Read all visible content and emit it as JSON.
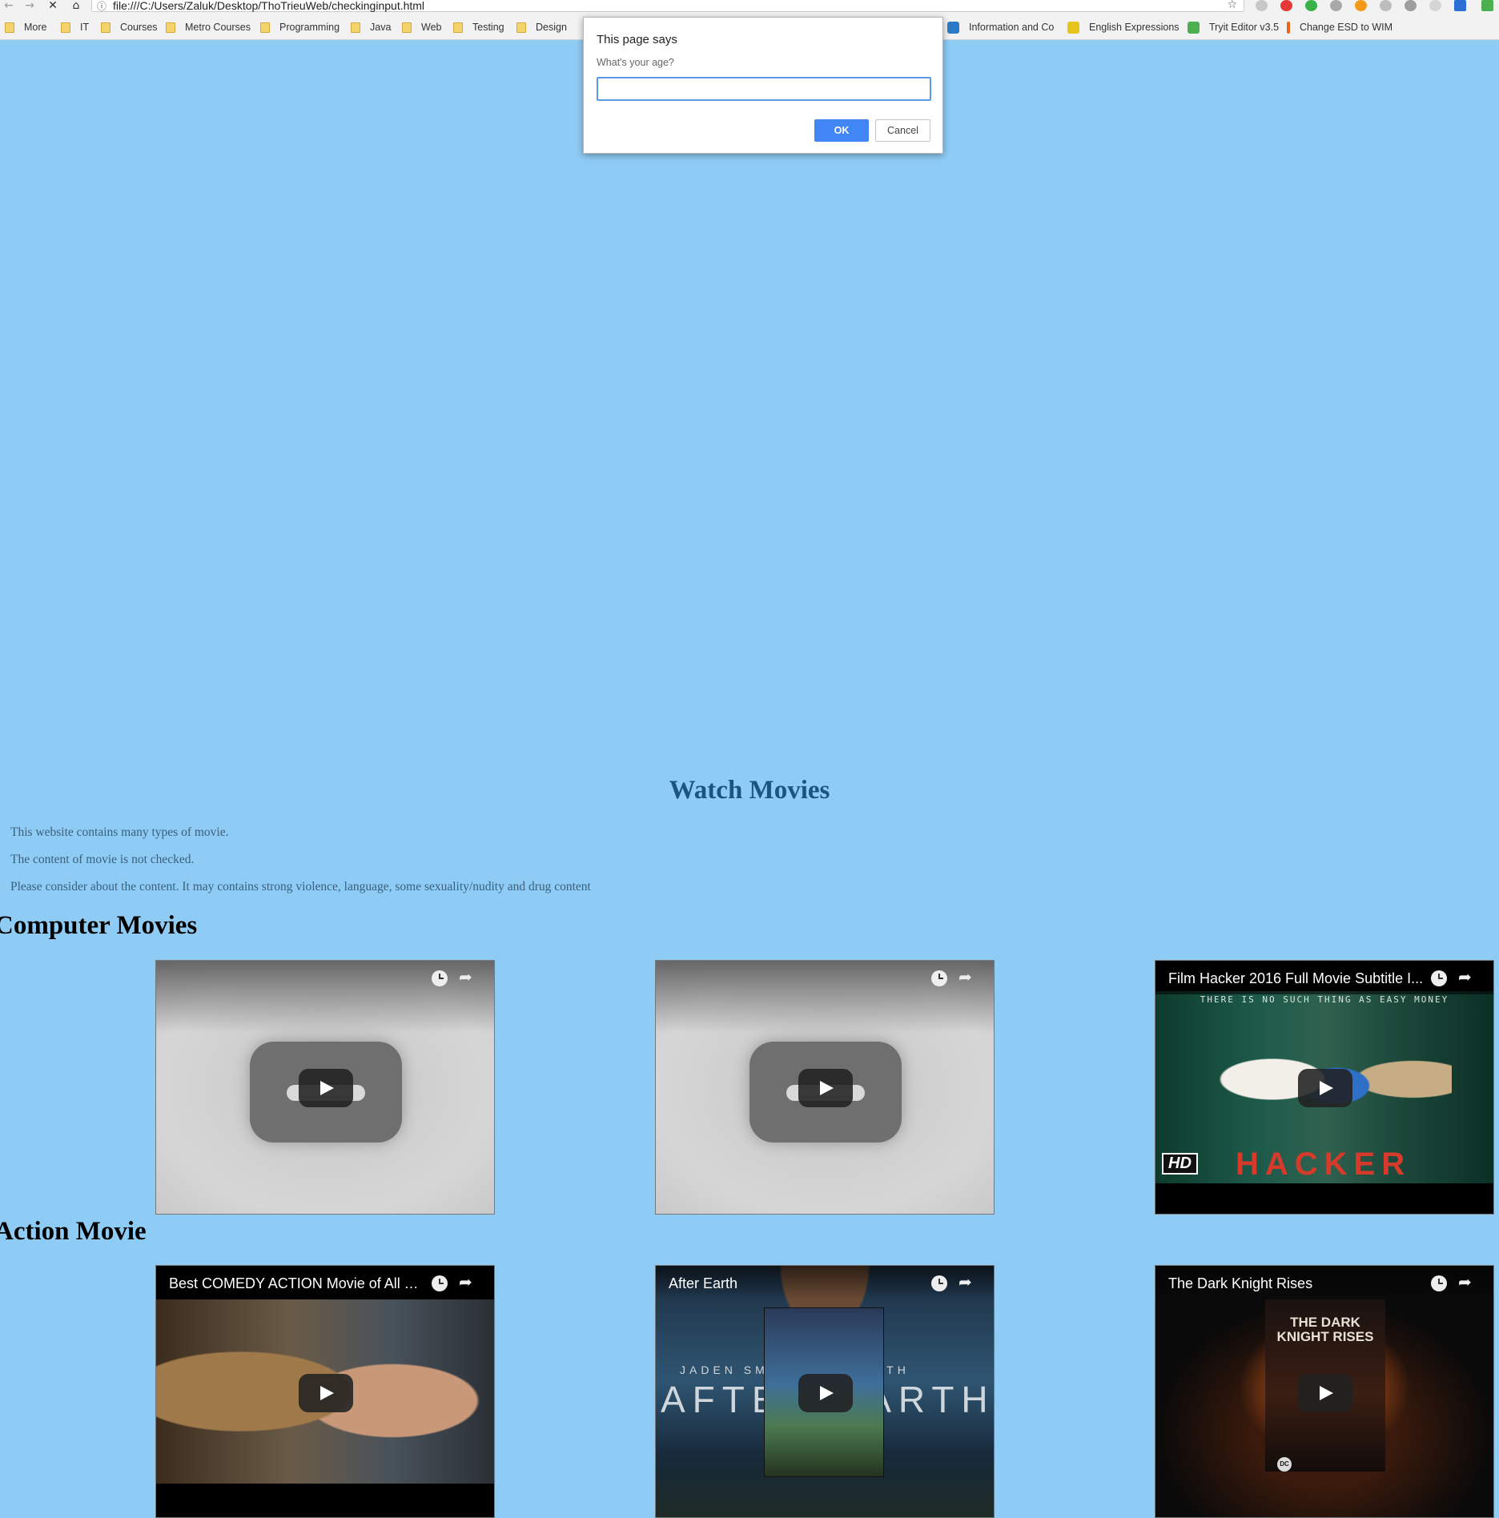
{
  "browser": {
    "url": "file:///C:/Users/Zaluk/Desktop/ThoTrieuWeb/checkinginput.html",
    "bookmarks": [
      {
        "label": "More",
        "type": "folder"
      },
      {
        "label": "IT",
        "type": "folder"
      },
      {
        "label": "Courses",
        "type": "folder"
      },
      {
        "label": "Metro Courses",
        "type": "folder"
      },
      {
        "label": "Programming",
        "type": "folder"
      },
      {
        "label": "Java",
        "type": "folder"
      },
      {
        "label": "Web",
        "type": "folder"
      },
      {
        "label": "Testing",
        "type": "folder"
      },
      {
        "label": "Design",
        "type": "folder"
      },
      {
        "label": "Information and Co",
        "type": "site",
        "color": "#2a7ac8"
      },
      {
        "label": "English Expressions",
        "type": "site",
        "color": "#e8c31a"
      },
      {
        "label": "Tryit Editor v3.5",
        "type": "site",
        "color": "#4caf50"
      },
      {
        "label": "Change ESD to WIM",
        "type": "site",
        "color": "#e8641a"
      }
    ]
  },
  "dialog": {
    "title": "This page says",
    "message": "What's your age?",
    "input_value": "",
    "ok_label": "OK",
    "cancel_label": "Cancel"
  },
  "page": {
    "title": "Watch Movies",
    "paragraphs": [
      "This website contains many types of movie.",
      "The content of movie is not checked.",
      "Please consider about the content. It may contains strong violence, language, some sexuality/nudity and drug content"
    ],
    "sections": [
      {
        "heading": "Computer Movies",
        "videos": [
          {
            "title": ""
          },
          {
            "title": ""
          },
          {
            "title": "Film Hacker 2016 Full Movie Subtitle I...",
            "poster_tag": "THERE IS NO SUCH THING AS EASY MONEY",
            "badge": "HD",
            "poster_text": "HACKER"
          }
        ]
      },
      {
        "heading": "Action Movie",
        "videos": [
          {
            "title": "Best COMEDY ACTION Movie of All Ti..."
          },
          {
            "title": "After Earth",
            "poster_names": "JADEN SMITH   WILL SMITH",
            "poster_text": "AFTER EARTH"
          },
          {
            "title": "The Dark Knight Rises",
            "poster_text": "THE DARK KNIGHT RISES",
            "badge": "DC"
          }
        ]
      }
    ]
  },
  "colors": {
    "page_background": "#8ecbf5",
    "title_color": "#1a5580",
    "ok_button": "#4285f4"
  }
}
